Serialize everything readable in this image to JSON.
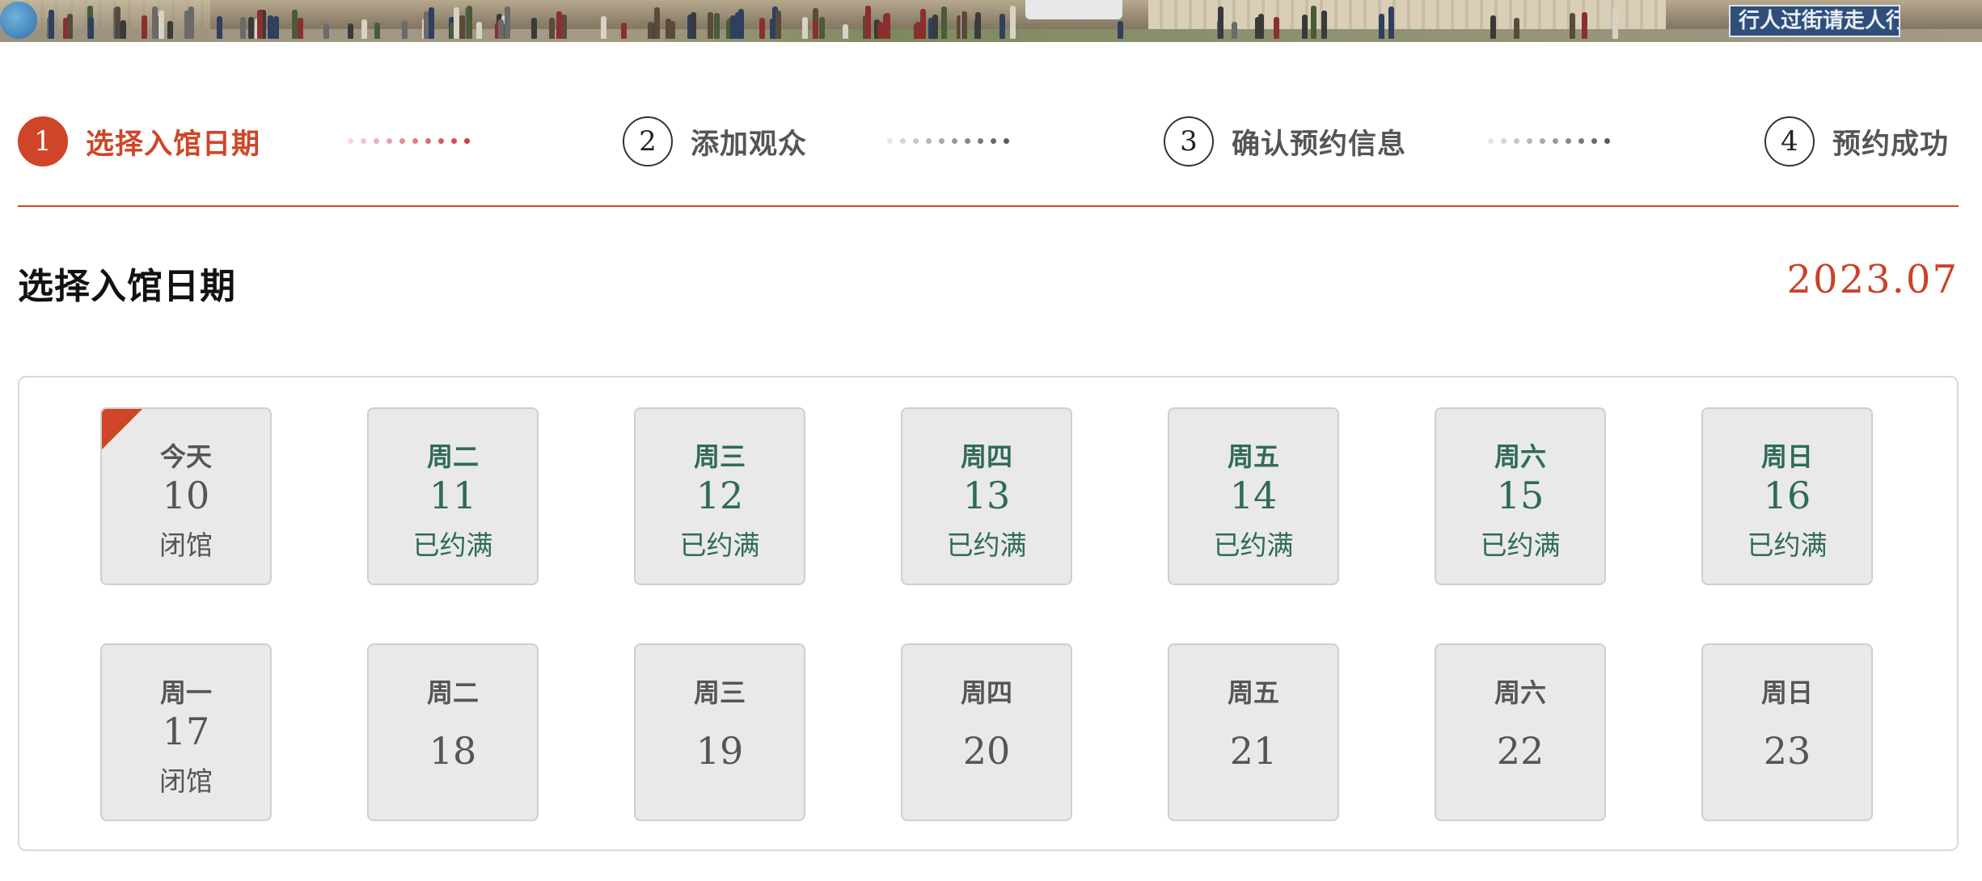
{
  "steps": [
    {
      "number": "1",
      "label": "选择入馆日期",
      "active": true
    },
    {
      "number": "2",
      "label": "添加观众",
      "active": false
    },
    {
      "number": "3",
      "label": "确认预约信息",
      "active": false
    },
    {
      "number": "4",
      "label": "预约成功",
      "active": false
    }
  ],
  "section": {
    "title": "选择入馆日期",
    "month": "2023.07"
  },
  "colors": {
    "accent": "#cf4527",
    "available_text": "#2f6b55",
    "cell_bg": "#e9e9e9"
  },
  "banner": {
    "sign_text": "行人过街请走人行通道"
  },
  "calendar": {
    "weeks": [
      [
        {
          "weekday": "今天",
          "date": "10",
          "status": "闭馆",
          "today": true
        },
        {
          "weekday": "周二",
          "date": "11",
          "status": "已约满"
        },
        {
          "weekday": "周三",
          "date": "12",
          "status": "已约满"
        },
        {
          "weekday": "周四",
          "date": "13",
          "status": "已约满"
        },
        {
          "weekday": "周五",
          "date": "14",
          "status": "已约满"
        },
        {
          "weekday": "周六",
          "date": "15",
          "status": "已约满"
        },
        {
          "weekday": "周日",
          "date": "16",
          "status": "已约满"
        }
      ],
      [
        {
          "weekday": "周一",
          "date": "17",
          "status": "闭馆"
        },
        {
          "weekday": "周二",
          "date": "18",
          "status": ""
        },
        {
          "weekday": "周三",
          "date": "19",
          "status": ""
        },
        {
          "weekday": "周四",
          "date": "20",
          "status": ""
        },
        {
          "weekday": "周五",
          "date": "21",
          "status": ""
        },
        {
          "weekday": "周六",
          "date": "22",
          "status": ""
        },
        {
          "weekday": "周日",
          "date": "23",
          "status": ""
        }
      ]
    ]
  }
}
